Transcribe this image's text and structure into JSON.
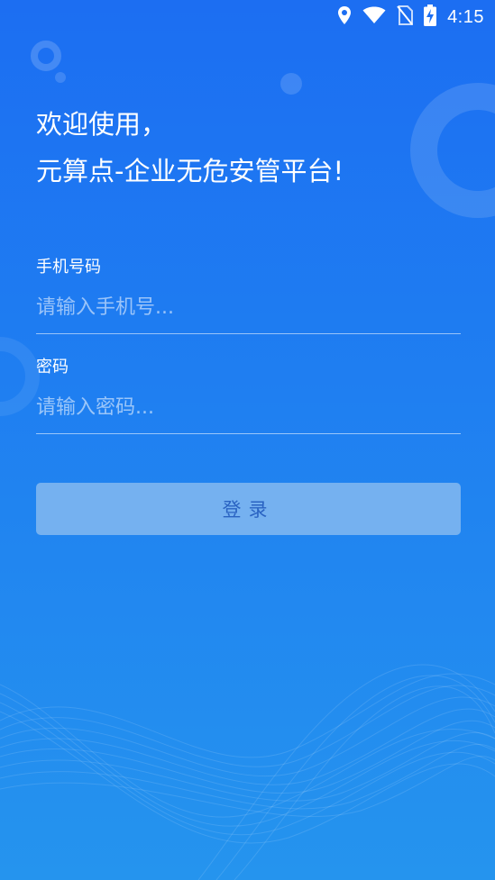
{
  "status_bar": {
    "time": "4:15",
    "icons": [
      "location-icon",
      "wifi-icon",
      "no-sim-icon",
      "battery-charging-icon"
    ]
  },
  "welcome": {
    "line1": "欢迎使用，",
    "line2": "元算点-企业无危安管平台!"
  },
  "form": {
    "phone": {
      "label": "手机号码",
      "placeholder": "请输入手机号...",
      "value": ""
    },
    "password": {
      "label": "密码",
      "placeholder": "请输入密码...",
      "value": ""
    },
    "login_label": "登录"
  },
  "colors": {
    "background_top": "#1c6ef2",
    "background_bottom": "#2594ee",
    "button_bg": "#aacdf0",
    "button_text": "#2a63c2"
  }
}
